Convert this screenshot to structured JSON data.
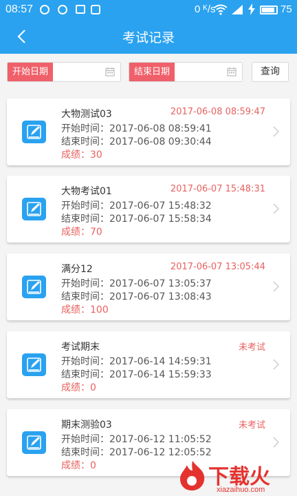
{
  "status_bar": {
    "time": "08:57",
    "network_speed": "0 ᴷ/s",
    "battery": "75"
  },
  "header": {
    "title": "考试记录"
  },
  "filter": {
    "start_label": "开始日期",
    "end_label": "结束日期",
    "query_label": "查询"
  },
  "records": [
    {
      "name": "大物测试03",
      "date": "2017-06-08 08:59:47",
      "start": "开始时间：2017-06-08 08:59:41",
      "end": "结束时间：2017-06-08 09:30:44",
      "score": "成绩：30"
    },
    {
      "name": "大物考试01",
      "date": "2017-06-07 15:48:31",
      "start": "开始时间：2017-06-07 15:48:32",
      "end": "结束时间：2017-06-07 15:58:34",
      "score": "成绩：70"
    },
    {
      "name": "满分12",
      "date": "2017-06-07 13:05:44",
      "start": "开始时间：2017-06-07 13:05:37",
      "end": "结束时间：2017-06-07 13:08:43",
      "score": "成绩：100"
    },
    {
      "name": "考试期末",
      "date": "未考试",
      "start": "开始时间：2017-06-14 14:59:31",
      "end": "结束时间：2017-06-14 15:59:33",
      "score": "成绩：0"
    },
    {
      "name": "期末测验03",
      "date": "未考试",
      "start": "开始时间：2017-06-12 11:05:52",
      "end": "结束时间：2017-06-12 12:05:52",
      "score": "成绩：0"
    }
  ],
  "watermark": {
    "text": "下载火",
    "url": "xiazaihuo.com"
  },
  "colors": {
    "header_blue": "#2aa2f0",
    "label_red": "#f0606a",
    "accent_red": "#e8615f"
  }
}
